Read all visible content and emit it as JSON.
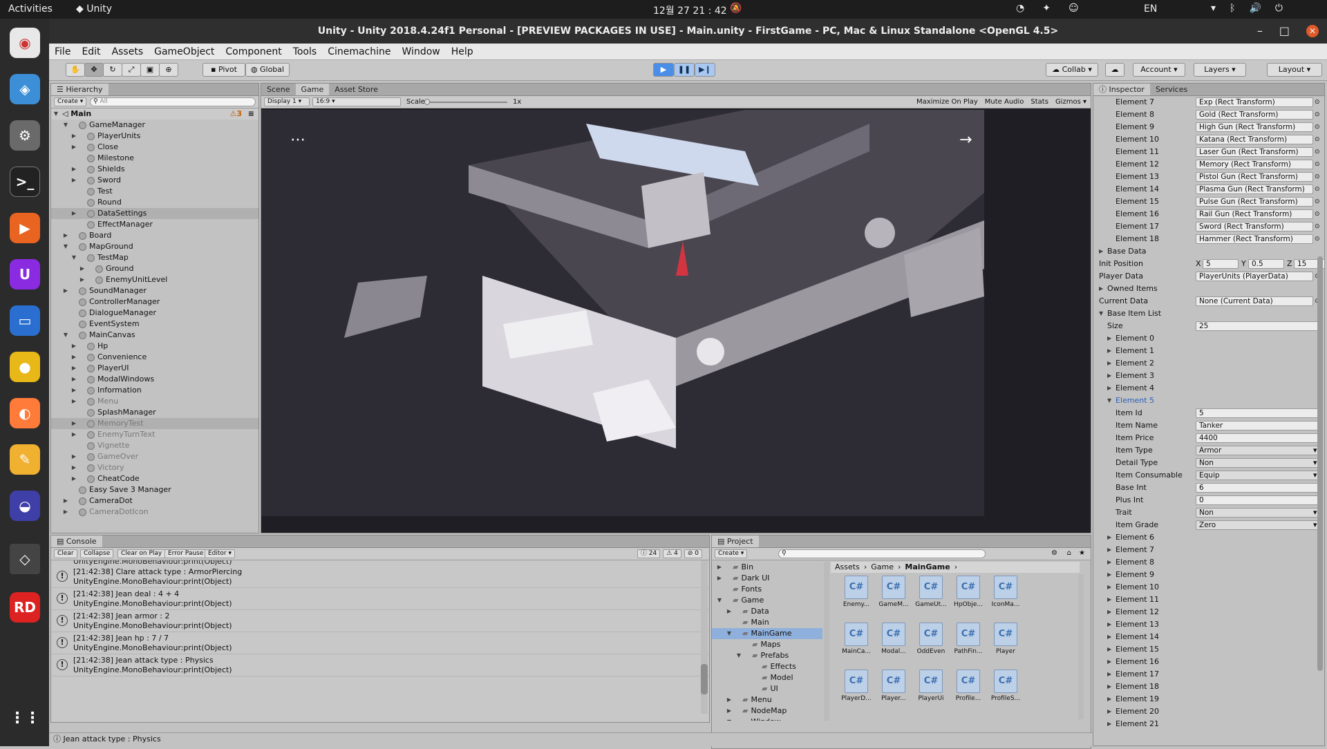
{
  "os": {
    "activities": "Activities",
    "app": "Unity",
    "clock": "12월 27  21 : 42",
    "lang": "EN"
  },
  "window": {
    "title": "Unity - Unity 2018.4.24f1 Personal - [PREVIEW PACKAGES IN USE] - Main.unity - FirstGame - PC, Mac & Linux Standalone <OpenGL 4.5>"
  },
  "menu": [
    "File",
    "Edit",
    "Assets",
    "GameObject",
    "Component",
    "Tools",
    "Cinemachine",
    "Window",
    "Help"
  ],
  "toolbar": {
    "pivot": "Pivot",
    "global": "Global",
    "collab": "Collab",
    "account": "Account",
    "layers": "Layers",
    "layout": "Layout"
  },
  "hierarchy": {
    "tab": "Hierarchy",
    "create": "Create",
    "search": "All",
    "scene": "Main",
    "count": "3",
    "items": [
      {
        "name": "GameManager",
        "d": 1,
        "e": "o"
      },
      {
        "name": "PlayerUnits",
        "d": 2,
        "e": "c"
      },
      {
        "name": "Close",
        "d": 2,
        "e": "c"
      },
      {
        "name": "Milestone",
        "d": 2,
        "e": ""
      },
      {
        "name": "Shields",
        "d": 2,
        "e": "c"
      },
      {
        "name": "Sword",
        "d": 2,
        "e": "c"
      },
      {
        "name": "Test",
        "d": 2,
        "e": ""
      },
      {
        "name": "Round",
        "d": 2,
        "e": ""
      },
      {
        "name": "DataSettings",
        "d": 2,
        "e": "c",
        "s": "sel"
      },
      {
        "name": "EffectManager",
        "d": 2,
        "e": ""
      },
      {
        "name": "Board",
        "d": 1,
        "e": "c"
      },
      {
        "name": "MapGround",
        "d": 1,
        "e": "o"
      },
      {
        "name": "TestMap",
        "d": 2,
        "e": "o"
      },
      {
        "name": "Ground",
        "d": 3,
        "e": "c"
      },
      {
        "name": "EnemyUnitLevel",
        "d": 3,
        "e": "c"
      },
      {
        "name": "SoundManager",
        "d": 1,
        "e": "c"
      },
      {
        "name": "ControllerManager",
        "d": 1,
        "e": ""
      },
      {
        "name": "DialogueManager",
        "d": 1,
        "e": ""
      },
      {
        "name": "EventSystem",
        "d": 1,
        "e": ""
      },
      {
        "name": "MainCanvas",
        "d": 1,
        "e": "o"
      },
      {
        "name": "Hp",
        "d": 2,
        "e": "c"
      },
      {
        "name": "Convenience",
        "d": 2,
        "e": "c"
      },
      {
        "name": "PlayerUI",
        "d": 2,
        "e": "c"
      },
      {
        "name": "ModalWindows",
        "d": 2,
        "e": "c"
      },
      {
        "name": "Information",
        "d": 2,
        "e": "c"
      },
      {
        "name": "Menu",
        "d": 2,
        "e": "c",
        "s": "dim"
      },
      {
        "name": "SplashManager",
        "d": 2,
        "e": ""
      },
      {
        "name": "MemoryTest",
        "d": 2,
        "e": "c",
        "s": "dim sel"
      },
      {
        "name": "EnemyTurnText",
        "d": 2,
        "e": "c",
        "s": "dim"
      },
      {
        "name": "Vignette",
        "d": 2,
        "e": "",
        "s": "dim"
      },
      {
        "name": "GameOver",
        "d": 2,
        "e": "c",
        "s": "dim"
      },
      {
        "name": "Victory",
        "d": 2,
        "e": "c",
        "s": "dim"
      },
      {
        "name": "CheatCode",
        "d": 2,
        "e": "c"
      },
      {
        "name": "Easy Save 3 Manager",
        "d": 1,
        "e": ""
      },
      {
        "name": "CameraDot",
        "d": 1,
        "e": "c"
      },
      {
        "name": "CameraDotIcon",
        "d": 1,
        "e": "c",
        "s": "dim"
      }
    ]
  },
  "scene_tabs": [
    "Scene",
    "Game",
    "Asset Store"
  ],
  "game_bar": {
    "display": "Display 1",
    "aspect": "16:9",
    "scale_label": "Scale",
    "scale_val": "1x",
    "maximize": "Maximize On Play",
    "mute": "Mute Audio",
    "stats": "Stats",
    "gizmos": "Gizmos"
  },
  "inspector": {
    "tab": "Inspector",
    "tab2": "Services",
    "rows": [
      {
        "k": "Element 7",
        "v": "Exp (Rect Transform)",
        "i": 2,
        "o": 1
      },
      {
        "k": "Element 8",
        "v": "Gold (Rect Transform)",
        "i": 2,
        "o": 1
      },
      {
        "k": "Element 9",
        "v": "High Gun (Rect Transform)",
        "i": 2,
        "o": 1
      },
      {
        "k": "Element 10",
        "v": "Katana (Rect Transform)",
        "i": 2,
        "o": 1
      },
      {
        "k": "Element 11",
        "v": "Laser Gun (Rect Transform)",
        "i": 2,
        "o": 1
      },
      {
        "k": "Element 12",
        "v": "Memory (Rect Transform)",
        "i": 2,
        "o": 1
      },
      {
        "k": "Element 13",
        "v": "Pistol Gun (Rect Transform)",
        "i": 2,
        "o": 1
      },
      {
        "k": "Element 14",
        "v": "Plasma Gun (Rect Transform)",
        "i": 2,
        "o": 1
      },
      {
        "k": "Element 15",
        "v": "Pulse Gun (Rect Transform)",
        "i": 2,
        "o": 1
      },
      {
        "k": "Element 16",
        "v": "Rail Gun (Rect Transform)",
        "i": 2,
        "o": 1
      },
      {
        "k": "Element 17",
        "v": "Sword (Rect Transform)",
        "i": 2,
        "o": 1
      },
      {
        "k": "Element 18",
        "v": "Hammer (Rect Transform)",
        "i": 2,
        "o": 1
      },
      {
        "k": "Base Data",
        "i": 0,
        "a": "c"
      },
      {
        "k": "Init Position",
        "i": 0,
        "xyz": [
          "5",
          "0.5",
          "15"
        ]
      },
      {
        "k": "Player Data",
        "v": "PlayerUnits (PlayerData)",
        "i": 0,
        "o": 1
      },
      {
        "k": "Owned Items",
        "i": 0,
        "a": "c"
      },
      {
        "k": "Current Data",
        "v": "None (Current Data)",
        "i": 0,
        "o": 1
      },
      {
        "k": "Base Item List",
        "i": 0,
        "a": "o"
      },
      {
        "k": "Size",
        "v": "25",
        "i": 1
      },
      {
        "k": "Element 0",
        "i": 1,
        "a": "c"
      },
      {
        "k": "Element 1",
        "i": 1,
        "a": "c"
      },
      {
        "k": "Element 2",
        "i": 1,
        "a": "c"
      },
      {
        "k": "Element 3",
        "i": 1,
        "a": "c"
      },
      {
        "k": "Element 4",
        "i": 1,
        "a": "c"
      },
      {
        "k": "Element 5",
        "i": 1,
        "a": "o",
        "blue": 1
      },
      {
        "k": "Item Id",
        "v": "5",
        "i": 2
      },
      {
        "k": "Item Name",
        "v": "Tanker",
        "i": 2
      },
      {
        "k": "Item Price",
        "v": "4400",
        "i": 2
      },
      {
        "k": "Item Type",
        "v": "Armor",
        "i": 2,
        "dd": 1
      },
      {
        "k": "Detail Type",
        "v": "Non",
        "i": 2,
        "dd": 1
      },
      {
        "k": "Item Consumable",
        "v": "Equip",
        "i": 2,
        "dd": 1
      },
      {
        "k": "Base Int",
        "v": "6",
        "i": 2
      },
      {
        "k": "Plus Int",
        "v": "0",
        "i": 2
      },
      {
        "k": "Trait",
        "v": "Non",
        "i": 2,
        "dd": 1
      },
      {
        "k": "Item Grade",
        "v": "Zero",
        "i": 2,
        "dd": 1
      },
      {
        "k": "Element 6",
        "i": 1,
        "a": "c"
      },
      {
        "k": "Element 7",
        "i": 1,
        "a": "c"
      },
      {
        "k": "Element 8",
        "i": 1,
        "a": "c"
      },
      {
        "k": "Element 9",
        "i": 1,
        "a": "c"
      },
      {
        "k": "Element 10",
        "i": 1,
        "a": "c"
      },
      {
        "k": "Element 11",
        "i": 1,
        "a": "c"
      },
      {
        "k": "Element 12",
        "i": 1,
        "a": "c"
      },
      {
        "k": "Element 13",
        "i": 1,
        "a": "c"
      },
      {
        "k": "Element 14",
        "i": 1,
        "a": "c"
      },
      {
        "k": "Element 15",
        "i": 1,
        "a": "c"
      },
      {
        "k": "Element 16",
        "i": 1,
        "a": "c"
      },
      {
        "k": "Element 17",
        "i": 1,
        "a": "c"
      },
      {
        "k": "Element 18",
        "i": 1,
        "a": "c"
      },
      {
        "k": "Element 19",
        "i": 1,
        "a": "c"
      },
      {
        "k": "Element 20",
        "i": 1,
        "a": "c"
      },
      {
        "k": "Element 21",
        "i": 1,
        "a": "c"
      }
    ]
  },
  "console": {
    "tab": "Console",
    "clear": "Clear",
    "collapse": "Collapse",
    "clear_on_play": "Clear on Play",
    "error_pause": "Error Pause",
    "editor": "Editor",
    "n_info": "24",
    "n_warn": "4",
    "n_err": "0",
    "partial": "UnityEngine.MonoBehaviour:print(Object)",
    "lines": [
      [
        "[21:42:38] Clare attack type : ArmorPiercing",
        "UnityEngine.MonoBehaviour:print(Object)"
      ],
      [
        "[21:42:38] Jean deal : 4 + 4",
        "UnityEngine.MonoBehaviour:print(Object)"
      ],
      [
        "[21:42:38] Jean armor : 2",
        "UnityEngine.MonoBehaviour:print(Object)"
      ],
      [
        "[21:42:38] Jean hp : 7 / 7",
        "UnityEngine.MonoBehaviour:print(Object)"
      ],
      [
        "[21:42:38] Jean attack type : Physics",
        "UnityEngine.MonoBehaviour:print(Object)"
      ]
    ]
  },
  "project": {
    "tab": "Project",
    "create": "Create",
    "tree": [
      {
        "n": "Bin",
        "d": 0,
        "e": "c"
      },
      {
        "n": "Dark UI",
        "d": 0,
        "e": "c"
      },
      {
        "n": "Fonts",
        "d": 0,
        "e": ""
      },
      {
        "n": "Game",
        "d": 0,
        "e": "o"
      },
      {
        "n": "Data",
        "d": 1,
        "e": "c"
      },
      {
        "n": "Main",
        "d": 1,
        "e": ""
      },
      {
        "n": "MainGame",
        "d": 1,
        "e": "o",
        "sel": 1
      },
      {
        "n": "Maps",
        "d": 2,
        "e": ""
      },
      {
        "n": "Prefabs",
        "d": 2,
        "e": "o"
      },
      {
        "n": "Effects",
        "d": 3,
        "e": ""
      },
      {
        "n": "Model",
        "d": 3,
        "e": ""
      },
      {
        "n": "UI",
        "d": 3,
        "e": ""
      },
      {
        "n": "Menu",
        "d": 1,
        "e": "c"
      },
      {
        "n": "NodeMap",
        "d": 1,
        "e": "c"
      },
      {
        "n": "Window",
        "d": 1,
        "e": "o"
      }
    ],
    "crumbs": [
      "Assets",
      "Game",
      "MainGame"
    ],
    "files": [
      "Enemy...",
      "GameM...",
      "GameUt...",
      "HpObje...",
      "IconMa...",
      "MainCa...",
      "Modal...",
      "OddEven",
      "PathFin...",
      "Player",
      "PlayerD...",
      "Player...",
      "PlayerUi",
      "Profile...",
      "ProfileS..."
    ]
  },
  "status": {
    "text": "Jean attack type : Physics"
  },
  "colors": {
    "accent": "#3d7ac8",
    "play_active": "#4a8ee8"
  }
}
